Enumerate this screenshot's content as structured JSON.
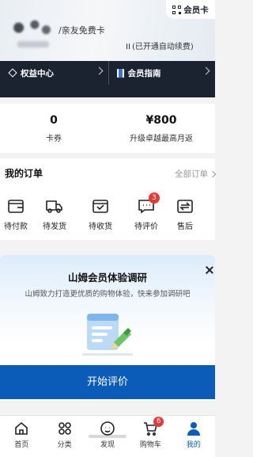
{
  "member": {
    "card_name": "/亲友免费卡",
    "auto_renew": "(已开通自动续费)",
    "member_card_button": "会员卡",
    "links": [
      {
        "label": "权益中心",
        "icon": "diamond-icon"
      },
      {
        "label": "会员指南",
        "icon": "guide-icon"
      }
    ]
  },
  "stats": [
    {
      "value": "0",
      "label": "卡券"
    },
    {
      "value": "¥800",
      "label": "升级卓越最高月返"
    }
  ],
  "orders": {
    "title": "我的订单",
    "all_label": "全部订单",
    "items": [
      {
        "label": "待付款",
        "icon": "wallet-icon"
      },
      {
        "label": "待发货",
        "icon": "truck-icon"
      },
      {
        "label": "待收货",
        "icon": "box-icon"
      },
      {
        "label": "待评价",
        "icon": "comment-icon",
        "badge": "3"
      },
      {
        "label": "售后",
        "icon": "return-icon"
      }
    ]
  },
  "survey": {
    "title": "山姆会员体验调研",
    "description": "山姆致力打造更优质的购物体验，快来参加调研吧",
    "button": "开始评价"
  },
  "tabbar": {
    "active": "我的",
    "items": [
      {
        "label": "首页",
        "icon": "home-icon"
      },
      {
        "label": "分类",
        "icon": "category-icon"
      },
      {
        "label": "发现",
        "icon": "discover-icon"
      },
      {
        "label": "购物车",
        "icon": "cart-icon",
        "badge": "6"
      },
      {
        "label": "我的",
        "icon": "profile-icon"
      }
    ]
  },
  "colors": {
    "accent": "#0b5bb8",
    "header_dark": "#1b2230",
    "badge": "#e53935"
  }
}
